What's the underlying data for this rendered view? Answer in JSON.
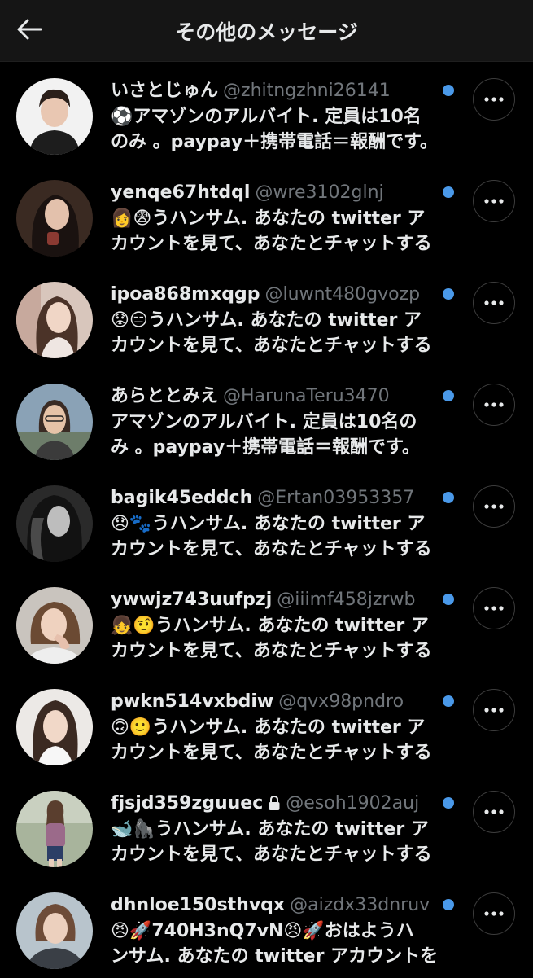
{
  "header": {
    "title": "その他のメッセージ",
    "back_icon": "arrow-left-icon"
  },
  "colors": {
    "unread_dot": "#4a99e9",
    "background": "#000000",
    "header_bg": "#151515",
    "handle": "#71767b"
  },
  "conversations": [
    {
      "display_name": "いさとじゅん",
      "handle": "@zhitngzhni26141",
      "unread": true,
      "line1": "⚽アマゾンのアルバイト. 定員は10名",
      "line2": "のみ 。paypay＋携帯電話＝報酬です。"
    },
    {
      "display_name": "yenqe67htdql",
      "handle": "@wre3102glnj",
      "unread": true,
      "line1": "👩😨うハンサム. あなたの twitter ア",
      "line2": "カウントを見て、あなたとチャットする"
    },
    {
      "display_name": "ipoa868mxqgp",
      "handle": "@luwnt480gvozp",
      "unread": true,
      "line1": "😟😑うハンサム. あなたの twitter ア",
      "line2": "カウントを見て、あなたとチャットする"
    },
    {
      "display_name": "あらととみえ",
      "handle": "@HarunaTeru3470",
      "unread": true,
      "line1": "アマゾンのアルバイト. 定員は10名の",
      "line2": "み 。paypay＋携帯電話＝報酬です。"
    },
    {
      "display_name": "bagik45eddch",
      "handle": "@Ertan03953357",
      "unread": true,
      "line1": "😞🐾うハンサム. あなたの twitter ア",
      "line2": "カウントを見て、あなたとチャットする"
    },
    {
      "display_name": "ywwjz743uufpzj",
      "handle": "@iiimf458jzrwb",
      "unread": true,
      "line1": "👧🤨うハンサム. あなたの twitter ア",
      "line2": "カウントを見て、あなたとチャットする"
    },
    {
      "display_name": "pwkn514vxbdiw",
      "handle": "@qvx98pndro",
      "unread": true,
      "line1": "🙃🙂うハンサム. あなたの twitter ア",
      "line2": "カウントを見て、あなたとチャットする"
    },
    {
      "display_name": "fjsjd359zguuec",
      "handle": "@esoh1902auj",
      "unread": true,
      "protected": true,
      "line1": "🐋🦍うハンサム. あなたの twitter ア",
      "line2": "カウントを見て、あなたとチャットする"
    },
    {
      "display_name": "dhnloe150sthvqx",
      "handle": "@aizdx33dnruv",
      "unread": true,
      "line1": "😠🚀740H3nQ7vN😠🚀おはようハ",
      "line2": "ンサム. あなたの twitter アカウントを"
    }
  ]
}
